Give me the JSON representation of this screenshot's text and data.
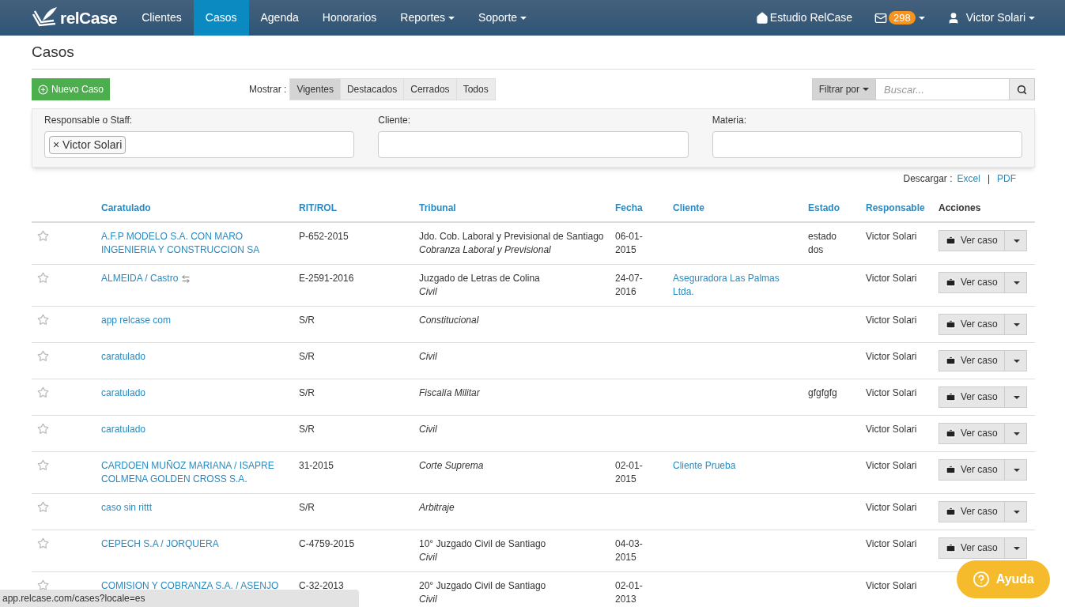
{
  "navbar": {
    "brand": "relCase",
    "items": [
      {
        "label": "Clientes",
        "selected": false,
        "dropdown": false
      },
      {
        "label": "Casos",
        "selected": true,
        "dropdown": false
      },
      {
        "label": "Agenda",
        "selected": false,
        "dropdown": false
      },
      {
        "label": "Honorarios",
        "selected": false,
        "dropdown": false
      },
      {
        "label": "Reportes",
        "selected": false,
        "dropdown": true
      },
      {
        "label": "Soporte",
        "selected": false,
        "dropdown": true
      }
    ],
    "office": "Estudio RelCase",
    "messages_count": "298",
    "user": "Victor Solari"
  },
  "page_title": "Casos",
  "toolbar": {
    "new_button": "Nuevo Caso",
    "show_label": "Mostrar :",
    "show_options": [
      {
        "label": "Vigentes",
        "selected": true
      },
      {
        "label": "Destacados",
        "selected": false
      },
      {
        "label": "Cerrados",
        "selected": false
      },
      {
        "label": "Todos",
        "selected": false
      }
    ],
    "filter_button": "Filtrar por",
    "search": {
      "placeholder": "Buscar..."
    }
  },
  "filters": [
    {
      "label": "Responsable o Staff:",
      "tags": [
        "Victor Solari"
      ],
      "remove_symbol": "×"
    },
    {
      "label": "Cliente:"
    },
    {
      "label": "Materia:"
    }
  ],
  "download": {
    "label": "Descargar :",
    "links": [
      "Excel",
      "PDF"
    ],
    "separator": "|"
  },
  "table": {
    "columns": [
      {
        "label": "Caratulado",
        "sortable": true
      },
      {
        "label": "RIT/ROL",
        "sortable": true
      },
      {
        "label": "Tribunal",
        "sortable": true
      },
      {
        "label": "Fecha",
        "sortable": true
      },
      {
        "label": "Cliente",
        "sortable": true
      },
      {
        "label": "Estado",
        "sortable": true
      },
      {
        "label": "Responsable",
        "sortable": true
      },
      {
        "label": "Acciones",
        "sortable": false
      }
    ],
    "rows": [
      {
        "starred": false,
        "caratulado": "A.F.P MODELO S.A. CON MARO INGENIERIA Y CONSTRUCCION SA",
        "linked": false,
        "rit": "P-652-2015",
        "tribunal": "Jdo. Cob. Laboral y Previsional de Santiago",
        "materia": "Cobranza Laboral y Previsional",
        "fecha": "06-01-2015",
        "cliente": "",
        "estado": "estado dos",
        "responsable": "Victor Solari",
        "action": "Ver caso"
      },
      {
        "starred": false,
        "caratulado": "ALMEIDA / Castro",
        "linked": true,
        "rit": "E-2591-2016",
        "tribunal": "Juzgado de Letras de Colina",
        "materia": "Civil",
        "fecha": "24-07-2016",
        "cliente": "Aseguradora Las Palmas Ltda.",
        "estado": "",
        "responsable": "Victor Solari",
        "action": "Ver caso"
      },
      {
        "starred": false,
        "caratulado": "app relcase com",
        "linked": false,
        "rit": "S/R",
        "tribunal": "",
        "materia": "Constitucional",
        "fecha": "",
        "cliente": "",
        "estado": "",
        "responsable": "Victor Solari",
        "action": "Ver caso"
      },
      {
        "starred": false,
        "caratulado": "caratulado",
        "linked": false,
        "rit": "S/R",
        "tribunal": "",
        "materia": "Civil",
        "fecha": "",
        "cliente": "",
        "estado": "",
        "responsable": "Victor Solari",
        "action": "Ver caso"
      },
      {
        "starred": false,
        "caratulado": "caratulado",
        "linked": false,
        "rit": "S/R",
        "tribunal": "",
        "materia": "Fiscalía Militar",
        "fecha": "",
        "cliente": "",
        "estado": "gfgfgfg",
        "responsable": "Victor Solari",
        "action": "Ver caso"
      },
      {
        "starred": false,
        "caratulado": "caratulado",
        "linked": false,
        "rit": "S/R",
        "tribunal": "",
        "materia": "Civil",
        "fecha": "",
        "cliente": "",
        "estado": "",
        "responsable": "Victor Solari",
        "action": "Ver caso"
      },
      {
        "starred": false,
        "caratulado": "CARDOEN MUÑOZ MARIANA / ISAPRE COLMENA GOLDEN CROSS S.A.",
        "linked": false,
        "rit": "31-2015",
        "tribunal": "",
        "materia": "Corte Suprema",
        "fecha": "02-01-2015",
        "cliente": "Cliente Prueba",
        "estado": "",
        "responsable": "Victor Solari",
        "action": "Ver caso"
      },
      {
        "starred": false,
        "caratulado": "caso sin rittt",
        "linked": false,
        "rit": "S/R",
        "tribunal": "",
        "materia": "Arbitraje",
        "fecha": "",
        "cliente": "",
        "estado": "",
        "responsable": "Victor Solari",
        "action": "Ver caso"
      },
      {
        "starred": false,
        "caratulado": "CEPECH S.A / JORQUERA",
        "linked": false,
        "rit": "C-4759-2015",
        "tribunal": "10° Juzgado Civil de Santiago",
        "materia": "Civil",
        "fecha": "04-03-2015",
        "cliente": "",
        "estado": "",
        "responsable": "Victor Solari",
        "action": "Ver caso"
      },
      {
        "starred": false,
        "caratulado": "COMISION Y COBRANZA S.A. / ASENJO",
        "linked": false,
        "rit": "C-32-2013",
        "tribunal": "20° Juzgado Civil de Santiago",
        "materia": "Civil",
        "fecha": "02-01-2013",
        "cliente": "",
        "estado": "",
        "responsable": "Victor Solari",
        "action": ""
      }
    ]
  },
  "status_url": "app.relcase.com/cases?locale=es",
  "help_button": "Ayuda"
}
